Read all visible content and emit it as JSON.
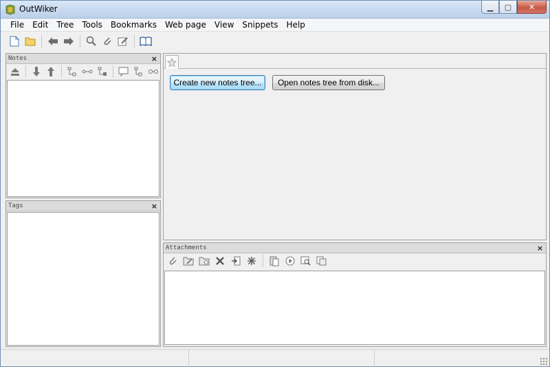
{
  "window": {
    "title": "OutWiker"
  },
  "menubar": {
    "items": [
      "File",
      "Edit",
      "Tree",
      "Tools",
      "Bookmarks",
      "Web page",
      "View",
      "Snippets",
      "Help"
    ]
  },
  "toolbar": {
    "icons": [
      "new-notes-tree-icon",
      "open-folder-icon",
      "back-arrow-icon",
      "forward-arrow-icon",
      "search-icon",
      "attach-icon",
      "edit-icon",
      "book-icon"
    ]
  },
  "notes_pane": {
    "title": "Notes",
    "close_label": "×"
  },
  "tags_pane": {
    "title": "Tags",
    "close_label": "×"
  },
  "main": {
    "create_button": "Create new notes tree...",
    "open_button": "Open notes tree from disk..."
  },
  "attachments_pane": {
    "title": "Attachments",
    "close_label": "×"
  },
  "status": {
    "cells": [
      "",
      "",
      ""
    ]
  },
  "colors": {
    "titlebar": "#c4d7ee",
    "accent": "#3c7fb1",
    "close_button": "#c75a45"
  }
}
